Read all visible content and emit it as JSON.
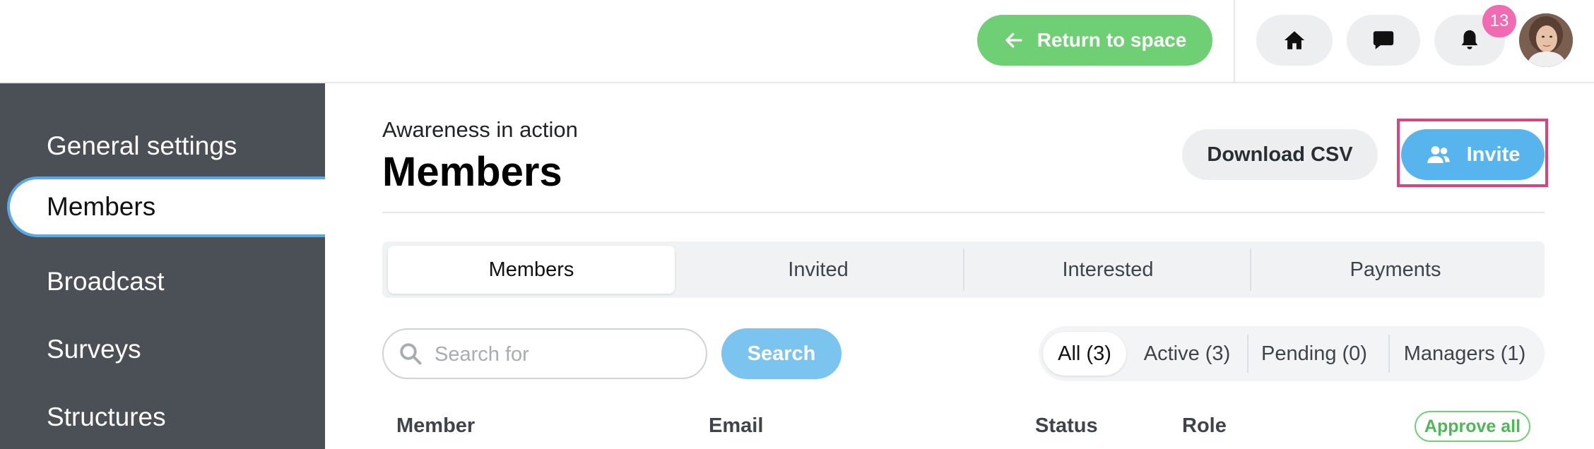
{
  "topbar": {
    "return_label": "Return to space",
    "notification_count": "13",
    "icons": [
      "arrow-left-icon",
      "home-icon",
      "chat-icon",
      "bell-icon"
    ]
  },
  "sidebar": {
    "items": [
      {
        "label": "General settings",
        "active": false
      },
      {
        "label": "Members",
        "active": true
      },
      {
        "label": "Broadcast",
        "active": false
      },
      {
        "label": "Surveys",
        "active": false
      },
      {
        "label": "Structures",
        "active": false
      }
    ]
  },
  "header": {
    "space_name": "Awareness in action",
    "title": "Members",
    "download_label": "Download CSV",
    "invite_label": "Invite"
  },
  "tabs": [
    {
      "label": "Members",
      "active": true
    },
    {
      "label": "Invited",
      "active": false
    },
    {
      "label": "Interested",
      "active": false
    },
    {
      "label": "Payments",
      "active": false
    }
  ],
  "search": {
    "placeholder": "Search for",
    "value": "",
    "button_label": "Search"
  },
  "filters": [
    {
      "label": "All (3)",
      "active": true
    },
    {
      "label": "Active (3)",
      "active": false
    },
    {
      "label": "Pending (0)",
      "active": false
    },
    {
      "label": "Managers (1)",
      "active": false
    }
  ],
  "table": {
    "columns": [
      "Member",
      "Email",
      "Status",
      "Role"
    ],
    "approve_all_label": "Approve all"
  },
  "colors": {
    "return_button": "#6fcf74",
    "invite_button": "#58b4ed",
    "search_button": "#7cc4f0",
    "badge": "#f06bb2",
    "sidebar_bg": "#4b5057",
    "highlight_border": "#d9447f",
    "approve_border": "#6fcf74"
  }
}
